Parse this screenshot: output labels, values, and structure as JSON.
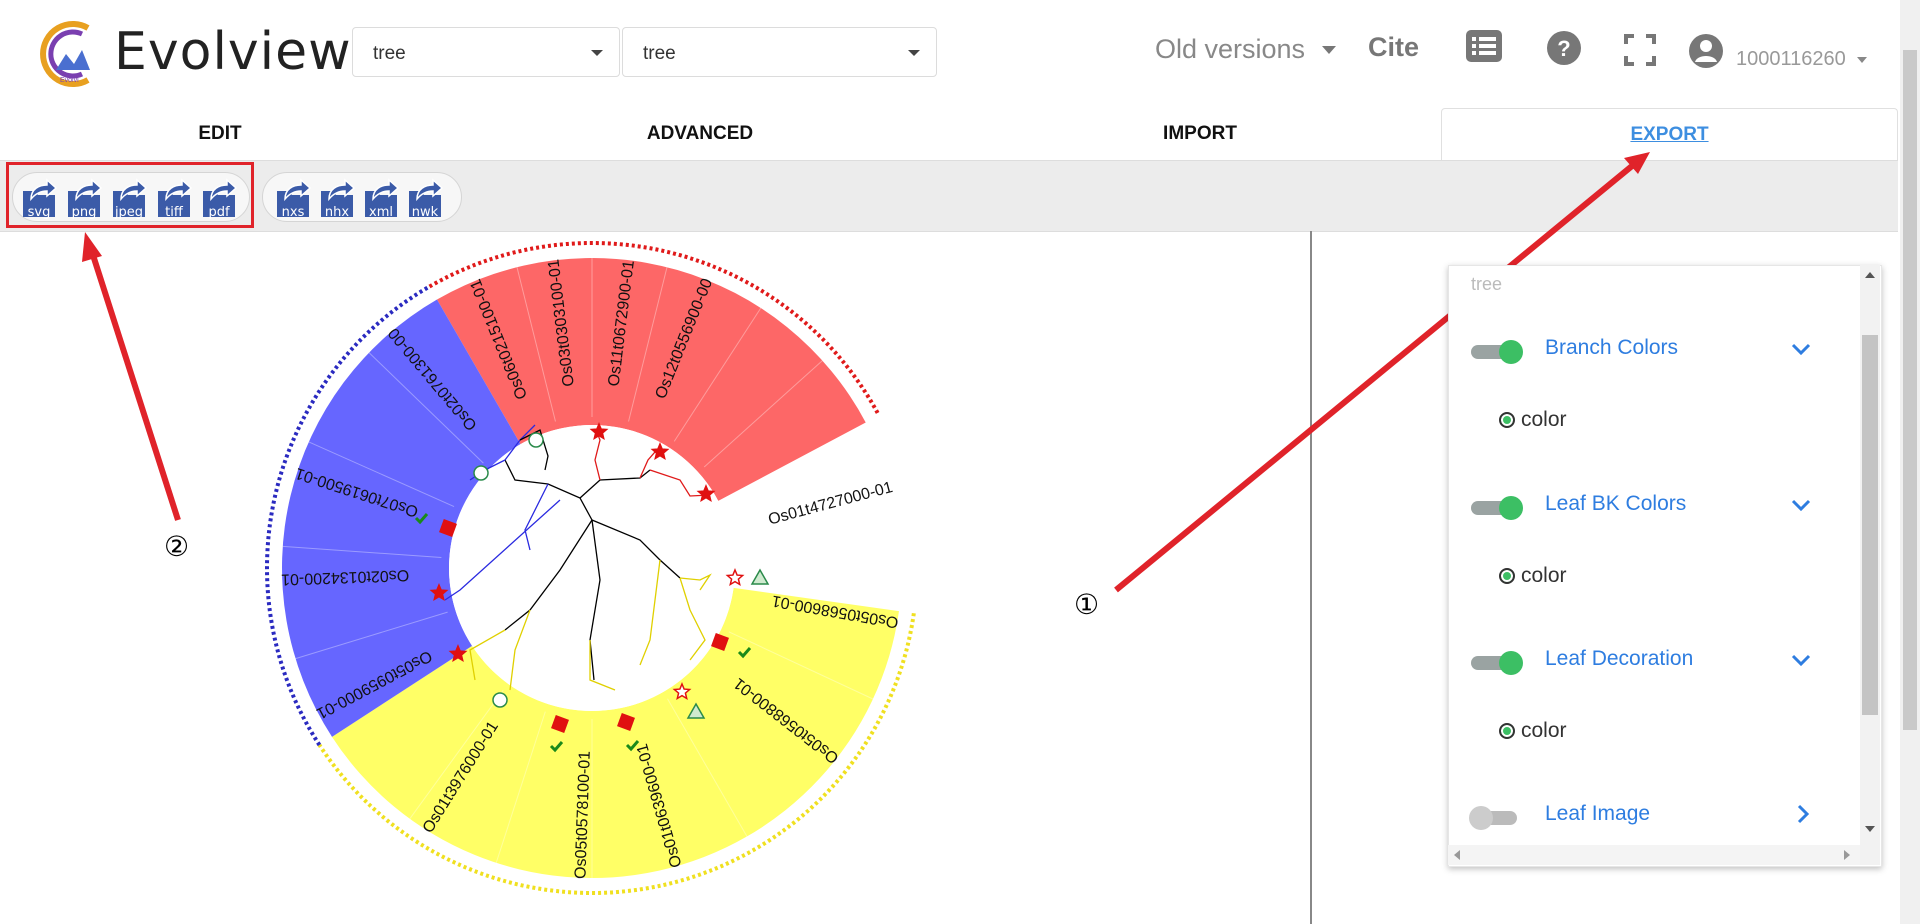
{
  "header": {
    "app_title": "Evolview",
    "select1_value": "tree",
    "select2_value": "tree",
    "old_versions": "Old versions",
    "cite": "Cite",
    "username": "1000116260"
  },
  "tabs": [
    {
      "label": "EDIT"
    },
    {
      "label": "ADVANCED"
    },
    {
      "label": "IMPORT"
    },
    {
      "label": "EXPORT",
      "active": true
    }
  ],
  "toolbar": {
    "export_buttons": [
      "svg",
      "png",
      "jpeg",
      "tiff",
      "pdf"
    ],
    "tree_buttons": [
      "nxs",
      "nhx",
      "xml",
      "nwk"
    ]
  },
  "tree": {
    "leaves": [
      {
        "label": "Os06t0215100-01"
      },
      {
        "label": "Os03t0303100-01"
      },
      {
        "label": "Os11t0672900-01"
      },
      {
        "label": "Os12t0556900-00"
      },
      {
        "label": "Os02t0761300-00"
      },
      {
        "label": "Os07t0619500-01"
      },
      {
        "label": "Os02t0134200-01"
      },
      {
        "label": "Os05t0959000-01"
      },
      {
        "label": "Os01t4727000-01"
      },
      {
        "label": "Os05t0568600-01"
      },
      {
        "label": "Os05t0568800-01"
      },
      {
        "label": "Os01t0639600-01"
      },
      {
        "label": "Os05t0578100-01"
      },
      {
        "label": "Os01t3976000-01"
      }
    ],
    "colors": {
      "red": "#fd6767",
      "blue": "#6666ff",
      "yellow": "#ffff66"
    }
  },
  "panel": {
    "tree_label": "tree",
    "rows": [
      {
        "title": "Branch Colors",
        "enabled": true,
        "expanded": true,
        "sub": "color"
      },
      {
        "title": "Leaf BK Colors",
        "enabled": true,
        "expanded": true,
        "sub": "color"
      },
      {
        "title": "Leaf Decoration",
        "enabled": true,
        "expanded": true,
        "sub": "color"
      },
      {
        "title": "Leaf Image",
        "enabled": false,
        "expanded": false
      }
    ]
  },
  "annotations": {
    "one": "①",
    "two": "②"
  }
}
